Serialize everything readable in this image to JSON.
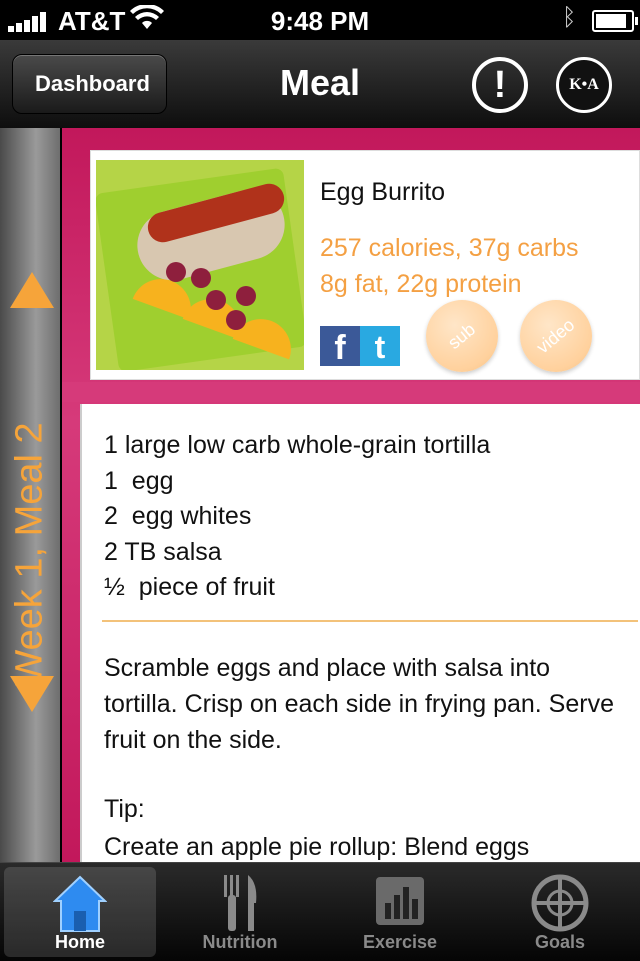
{
  "status": {
    "carrier": "AT&T",
    "time": "9:48 PM"
  },
  "navbar": {
    "back_label": "Dashboard",
    "title": "Meal",
    "alert_symbol": "!",
    "logo_text": "K•A"
  },
  "side": {
    "week_label": "Week 1, Meal 2"
  },
  "meal": {
    "name": "Egg Burrito",
    "stats_line1": "257 calories, 37g carbs",
    "stats_line2": "8g fat, 22g protein",
    "sub_label": "sub",
    "video_label": "video"
  },
  "recipe": {
    "ingredients": [
      "1 large low carb whole-grain tortilla",
      "1  egg",
      "2  egg whites",
      "2 TB salsa",
      "½  piece of fruit"
    ],
    "instructions": "Scramble eggs and place with salsa into tortilla. Crisp on each side in frying pan. Serve fruit on the side.",
    "tip_heading": "Tip:",
    "tip_text": "Create an apple pie rollup: Blend eggs"
  },
  "tabs": [
    {
      "label": "Home",
      "icon": "home-icon",
      "active": true
    },
    {
      "label": "Nutrition",
      "icon": "fork-knife-icon",
      "active": false
    },
    {
      "label": "Exercise",
      "icon": "bar-chart-icon",
      "active": false
    },
    {
      "label": "Goals",
      "icon": "target-icon",
      "active": false
    }
  ],
  "colors": {
    "accent": "#f4a043",
    "frame": "#c2185b",
    "nav": "#1a1a1a"
  }
}
